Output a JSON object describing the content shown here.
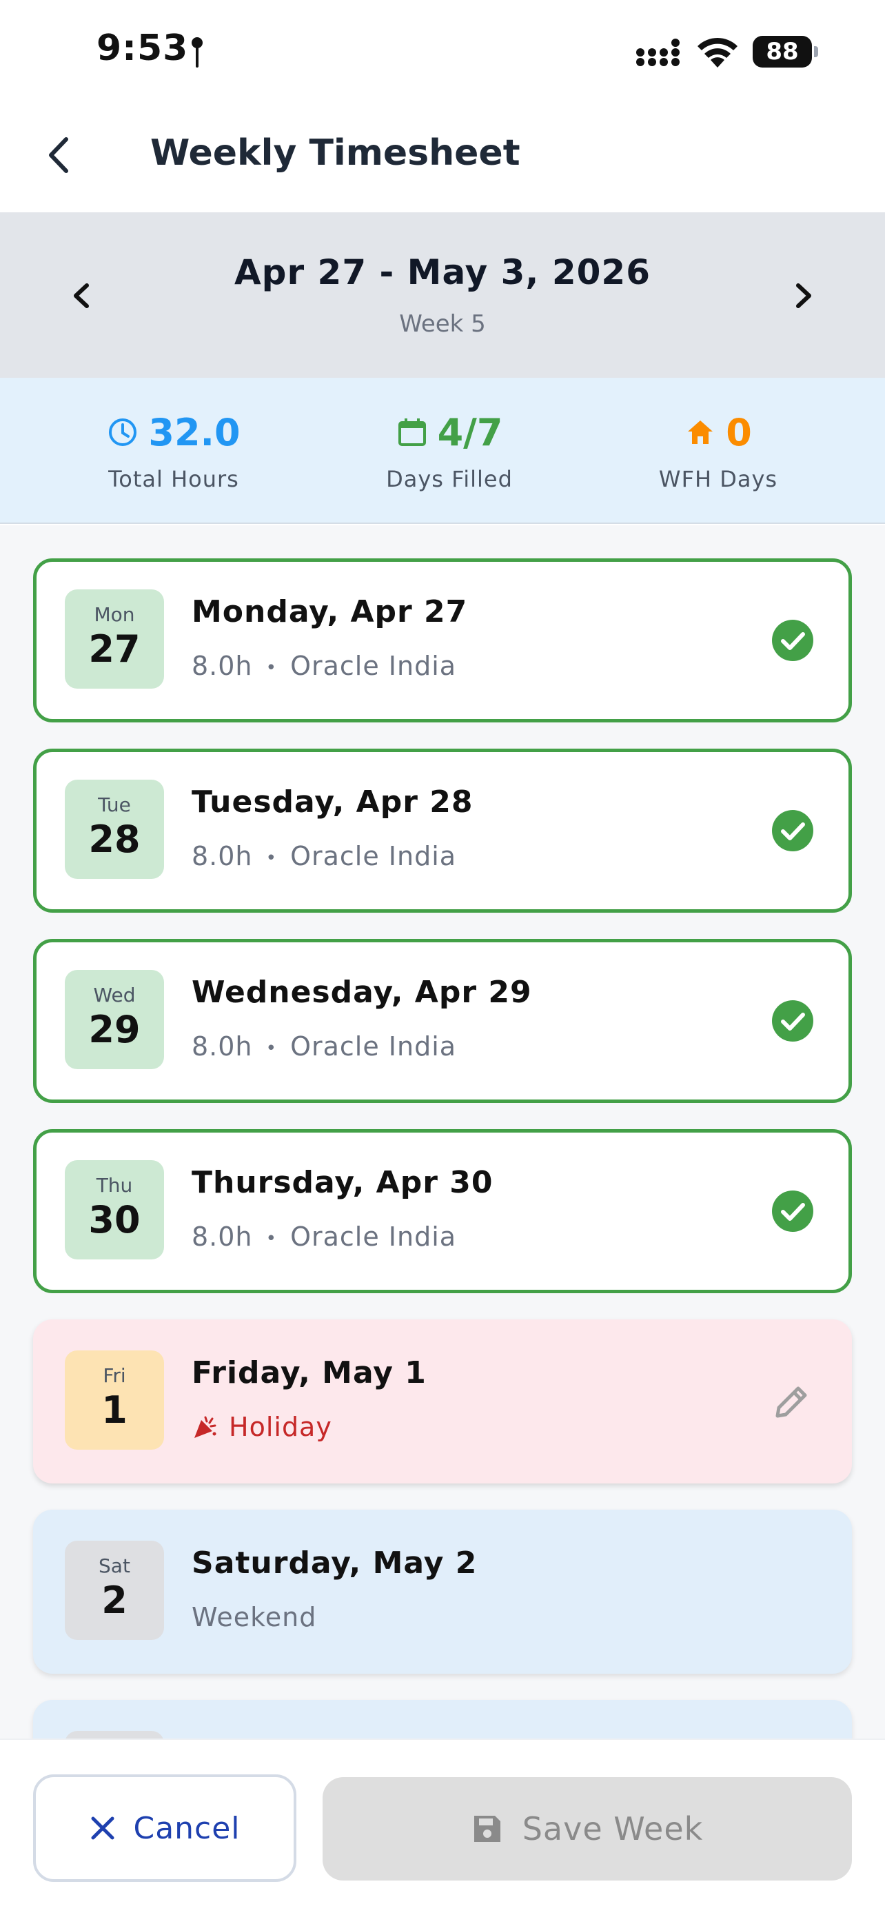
{
  "status_bar": {
    "time": "9:53",
    "battery": "88"
  },
  "header": {
    "title": "Weekly Timesheet"
  },
  "week": {
    "range": "Apr 27 - May 3, 2026",
    "label": "Week 5"
  },
  "summary": {
    "total_hours": {
      "value": "32.0",
      "label": "Total Hours",
      "color": "#2196f3"
    },
    "days_filled": {
      "value": "4/7",
      "label": "Days Filled",
      "color": "#43a047"
    },
    "wfh_days": {
      "value": "0",
      "label": "WFH Days",
      "color": "#fb8c00"
    }
  },
  "days": [
    {
      "dow": "Mon",
      "num": "27",
      "title": "Monday, Apr 27",
      "hours": "8.0h",
      "sep": "•",
      "client": "Oracle India",
      "status": "filled"
    },
    {
      "dow": "Tue",
      "num": "28",
      "title": "Tuesday, Apr 28",
      "hours": "8.0h",
      "sep": "•",
      "client": "Oracle India",
      "status": "filled"
    },
    {
      "dow": "Wed",
      "num": "29",
      "title": "Wednesday, Apr 29",
      "hours": "8.0h",
      "sep": "•",
      "client": "Oracle India",
      "status": "filled"
    },
    {
      "dow": "Thu",
      "num": "30",
      "title": "Thursday, Apr 30",
      "hours": "8.0h",
      "sep": "•",
      "client": "Oracle India",
      "status": "filled"
    },
    {
      "dow": "Fri",
      "num": "1",
      "title": "Friday, May 1",
      "sub": "Holiday",
      "status": "holiday"
    },
    {
      "dow": "Sat",
      "num": "2",
      "title": "Saturday, May 2",
      "sub": "Weekend",
      "status": "weekend"
    }
  ],
  "footer": {
    "cancel_label": "Cancel",
    "save_label": "Save Week"
  },
  "colors": {
    "accent_blue": "#1e40af",
    "filled_green": "#43a047",
    "holiday_red": "#c62828"
  }
}
